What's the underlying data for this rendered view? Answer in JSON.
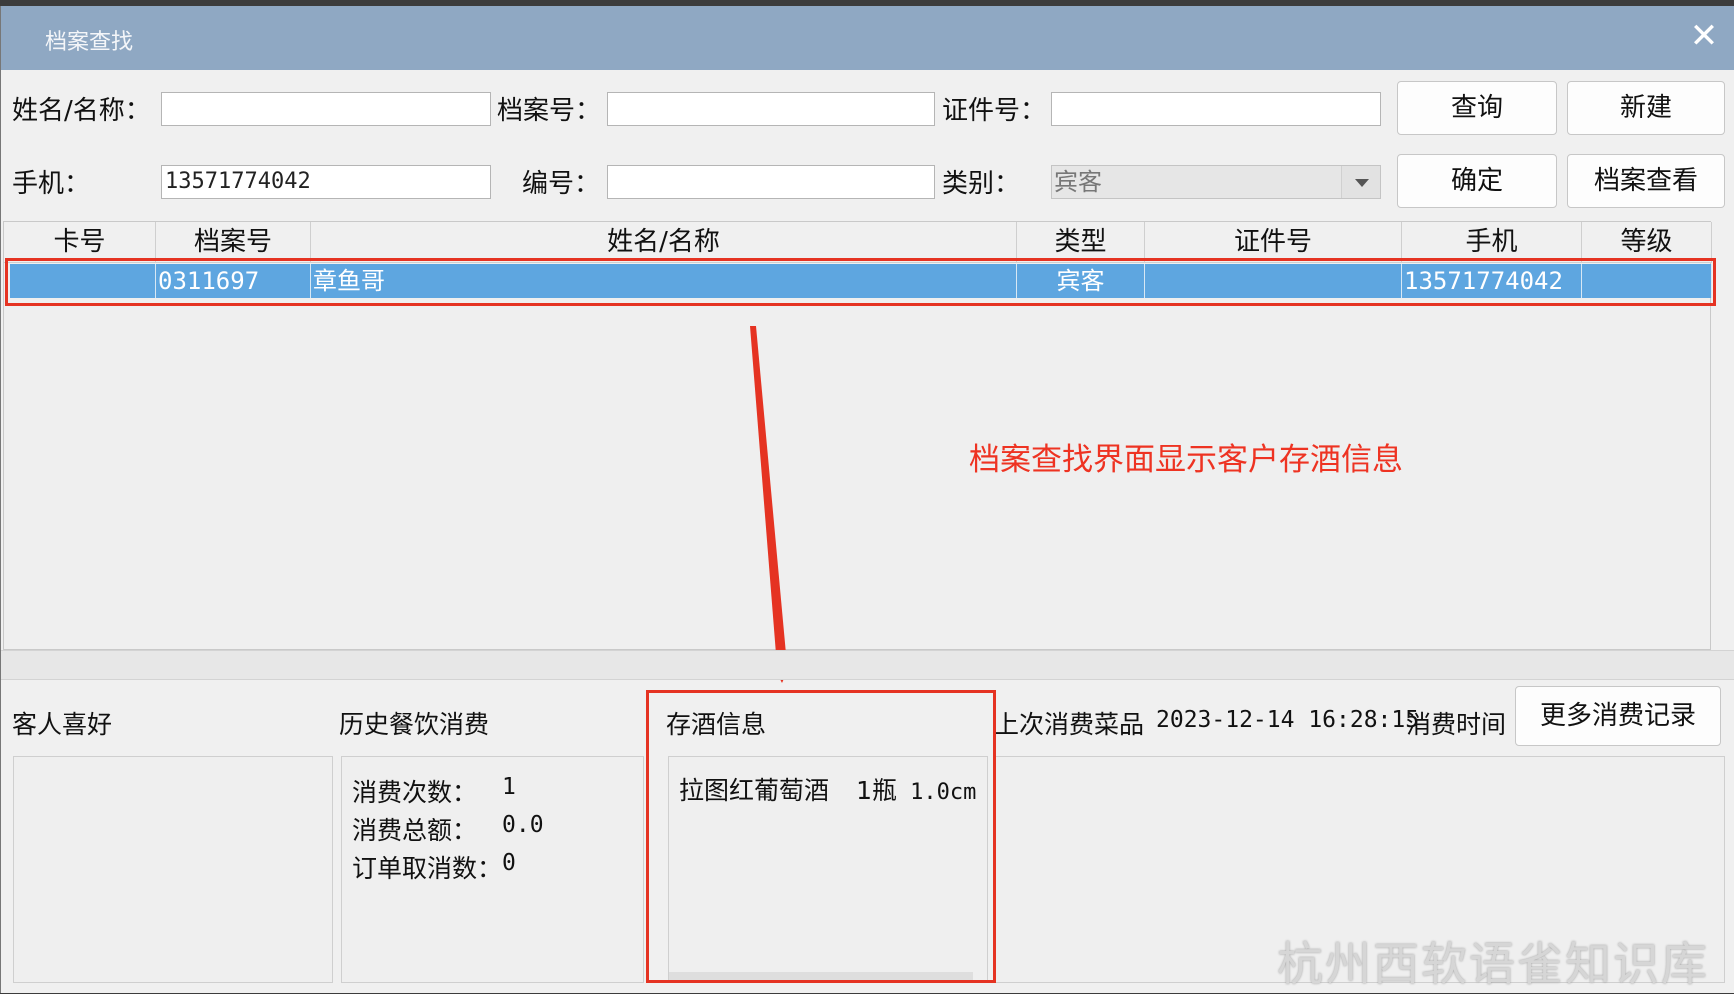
{
  "window": {
    "title": "档案查找",
    "close_glyph": "✕"
  },
  "search": {
    "name_label": "姓名/名称：",
    "name_value": "",
    "archive_no_label": "档案号：",
    "archive_no_value": "",
    "id_no_label": "证件号：",
    "id_no_value": "",
    "phone_label": "手机：",
    "phone_value": "13571774042",
    "code_label": "编号：",
    "code_value": "",
    "category_label": "类别：",
    "category_value": "宾客"
  },
  "buttons": {
    "query": "查询",
    "new": "新建",
    "confirm": "确定",
    "view_archive": "档案查看",
    "more_records": "更多消费记录"
  },
  "table": {
    "columns": [
      "卡号",
      "档案号",
      "姓名/名称",
      "类型",
      "证件号",
      "手机",
      "等级"
    ],
    "rows": [
      {
        "card_no": "",
        "archive_no": "0311697",
        "name": "章鱼哥",
        "type": "宾客",
        "id_no": "",
        "phone": "13571774042",
        "level": ""
      }
    ]
  },
  "annotation": {
    "text": "档案查找界面显示客户存酒信息",
    "color": "#ee3322"
  },
  "details": {
    "preferences_label": "客人喜好",
    "history_label": "历史餐饮消费",
    "visits_label": "消费次数：",
    "visits_value": "1",
    "total_label": "消费总额：",
    "total_value": "0.0",
    "cancelled_label": "订单取消数：",
    "cancelled_value": "0",
    "wine_label": "存酒信息",
    "wine_items": [
      {
        "name": "拉图红葡萄酒",
        "qty": "1瓶",
        "amount": "1.0cm"
      }
    ],
    "last_dishes_label": "上次消费菜品",
    "last_time_value": "2023-12-14 16:28:15",
    "last_time_label": "消费时间"
  },
  "watermark": "杭州西软语雀知识库",
  "colors": {
    "titlebar": "#8fa8c3",
    "selection": "#5ea6e0",
    "highlight": "#e53322"
  }
}
